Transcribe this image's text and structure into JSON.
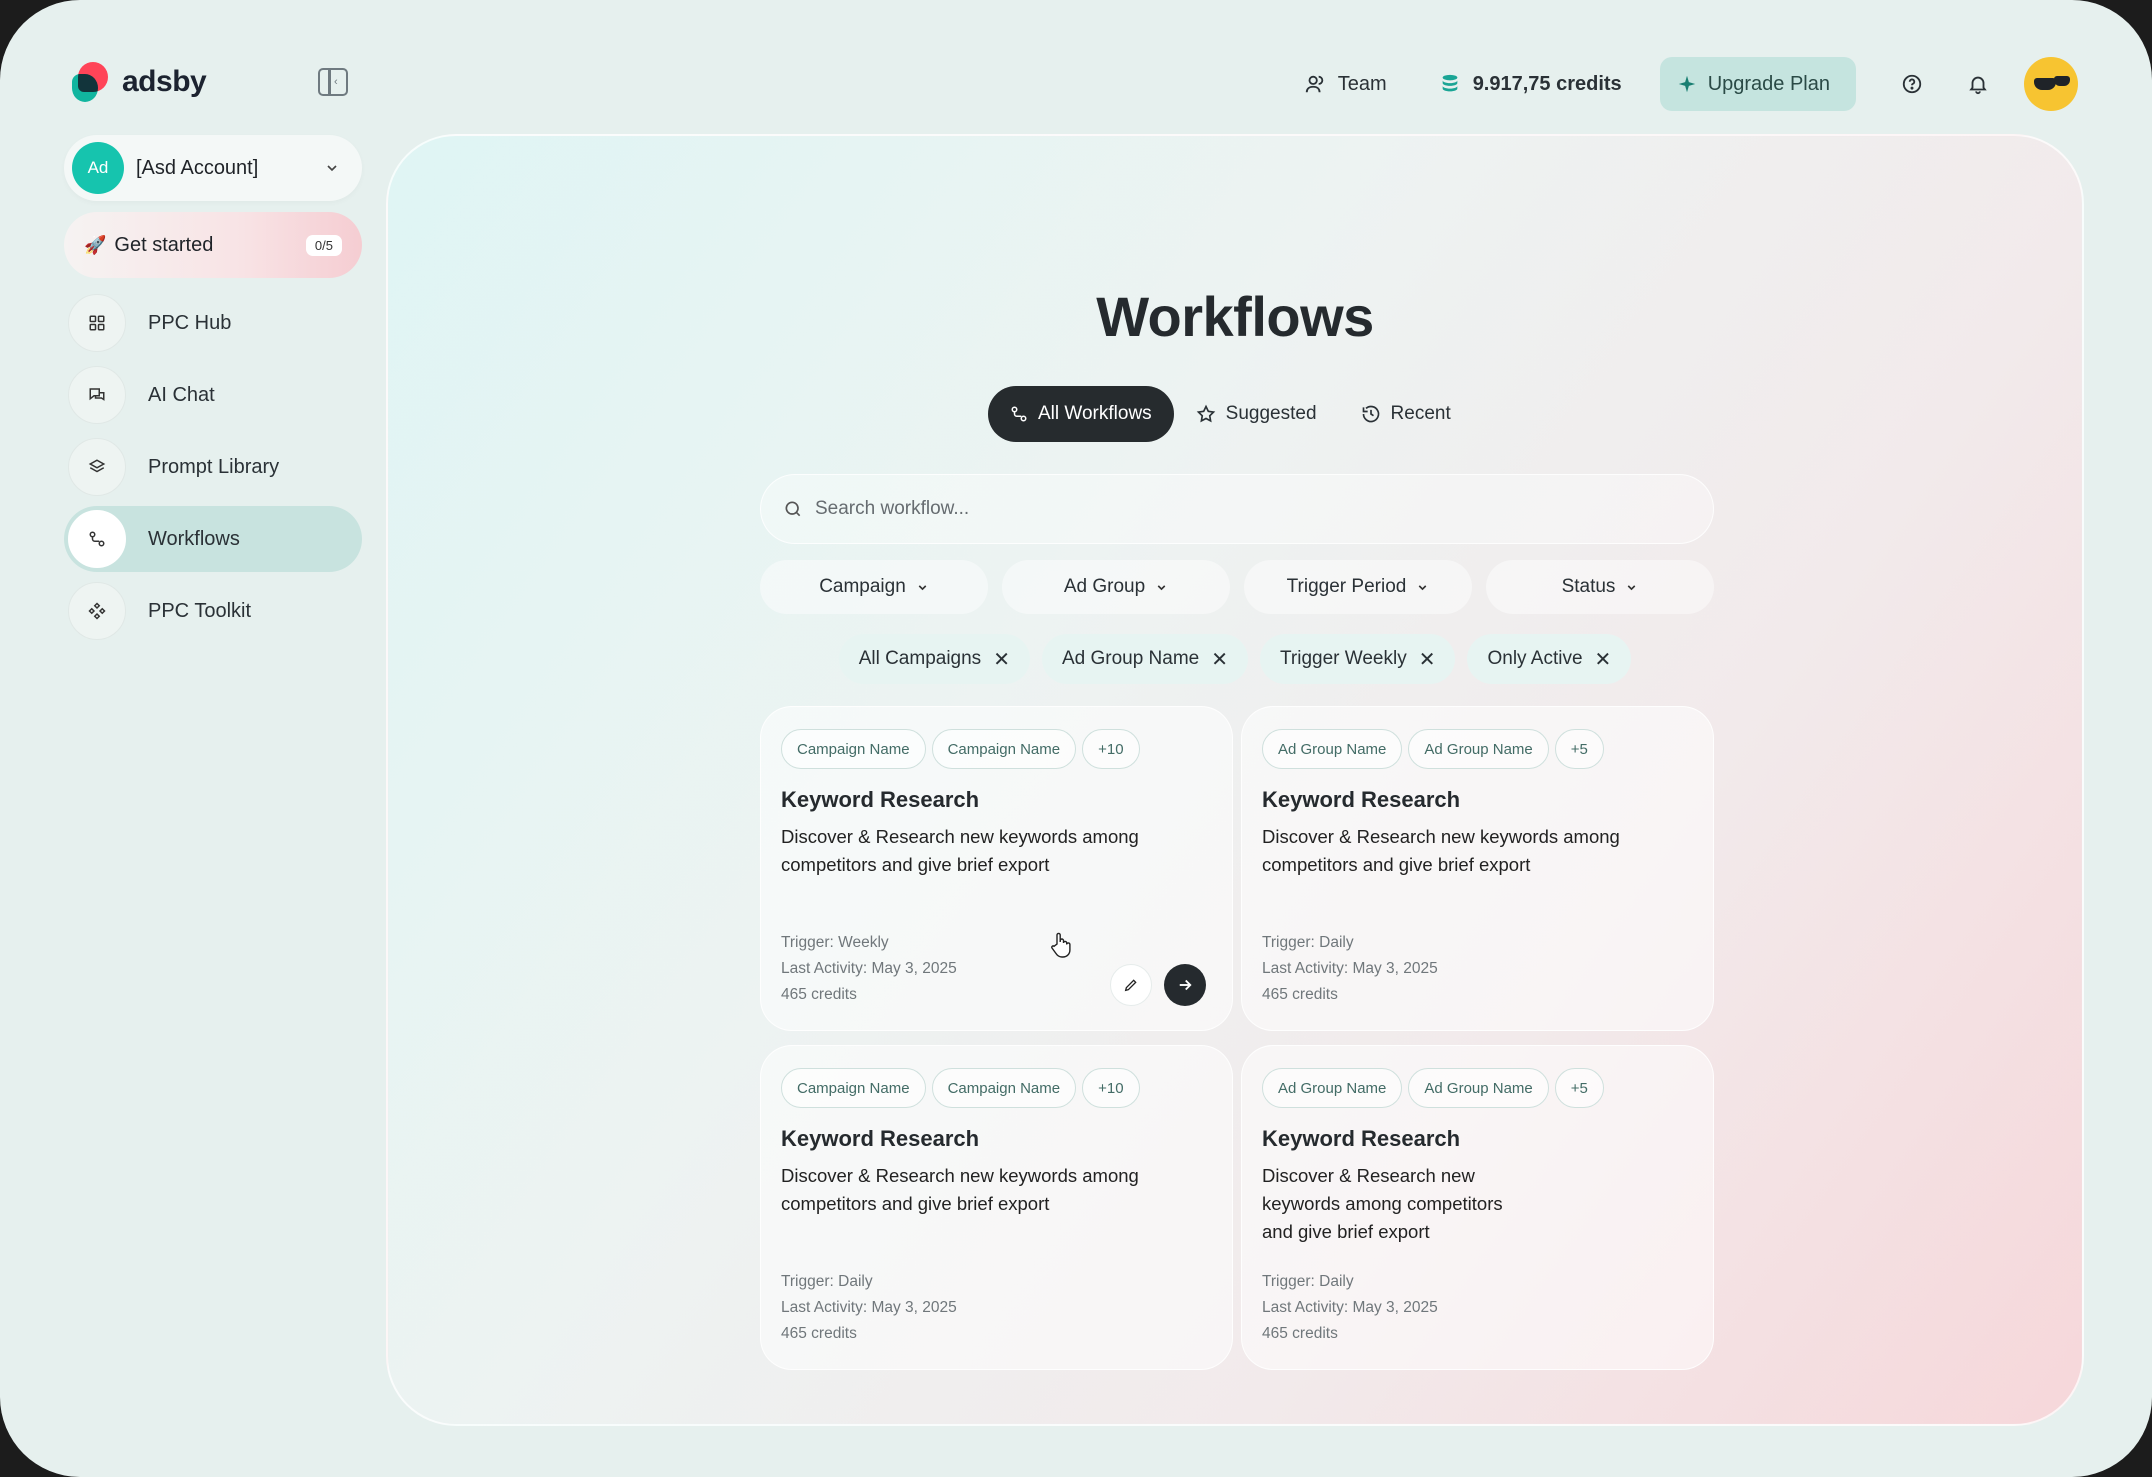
{
  "brand": {
    "name": "adsby"
  },
  "topnav": {
    "team_label": "Team",
    "credits_label": "9.917,75 credits",
    "upgrade_label": "Upgrade Plan"
  },
  "sidebar": {
    "account": {
      "badge": "Ad",
      "name": "[Asd Account]"
    },
    "get_started": {
      "label": "Get started",
      "progress": "0/5"
    },
    "items": [
      {
        "label": "PPC Hub",
        "icon": "grid-icon"
      },
      {
        "label": "AI Chat",
        "icon": "chat-icon"
      },
      {
        "label": "Prompt Library",
        "icon": "layers-icon"
      },
      {
        "label": "Workflows",
        "icon": "workflow-icon",
        "active": true
      },
      {
        "label": "PPC Toolkit",
        "icon": "toolkit-icon"
      }
    ]
  },
  "main": {
    "title": "Workflows",
    "tabs": [
      {
        "label": "All Workflows",
        "active": true
      },
      {
        "label": "Suggested"
      },
      {
        "label": "Recent"
      }
    ],
    "search": {
      "placeholder": "Search workflow..."
    },
    "filters": [
      "Campaign",
      "Ad Group",
      "Trigger Period",
      "Status"
    ],
    "active_filters": [
      "All Campaigns",
      "Ad Group Name",
      "Trigger Weekly",
      "Only Active"
    ],
    "cards": [
      {
        "tags": [
          "Campaign Name",
          "Campaign Name",
          "+10"
        ],
        "title": "Keyword Research",
        "description": "Discover & Research new keywords among competitors and give brief export",
        "trigger": "Trigger: Weekly",
        "last_activity": "Last Activity: May 3, 2025",
        "credits": "465 credits"
      },
      {
        "tags": [
          "Ad Group Name",
          "Ad Group Name",
          "+5"
        ],
        "title": "Keyword Research",
        "description": "Discover & Research new keywords among competitors and give brief export",
        "trigger": "Trigger: Daily",
        "last_activity": "Last Activity: May 3, 2025",
        "credits": "465 credits"
      },
      {
        "tags": [
          "Campaign Name",
          "Campaign Name",
          "+10"
        ],
        "title": "Keyword Research",
        "description": "Discover & Research new keywords among competitors and give brief export",
        "trigger": "Trigger: Daily",
        "last_activity": "Last Activity: May 3, 2025",
        "credits": "465 credits"
      },
      {
        "tags": [
          "Ad Group Name",
          "Ad Group Name",
          "+5"
        ],
        "title": "Keyword Research",
        "description": "Discover & Research new keywords among competitors and give brief export",
        "trigger": "Trigger: Daily",
        "last_activity": "Last Activity: May 3, 2025",
        "credits": "465 credits"
      }
    ]
  },
  "colors": {
    "accent": "#16c4ae",
    "brand_red": "#ff4458",
    "dark": "#262b2e",
    "active_nav": "#c8e3df"
  }
}
